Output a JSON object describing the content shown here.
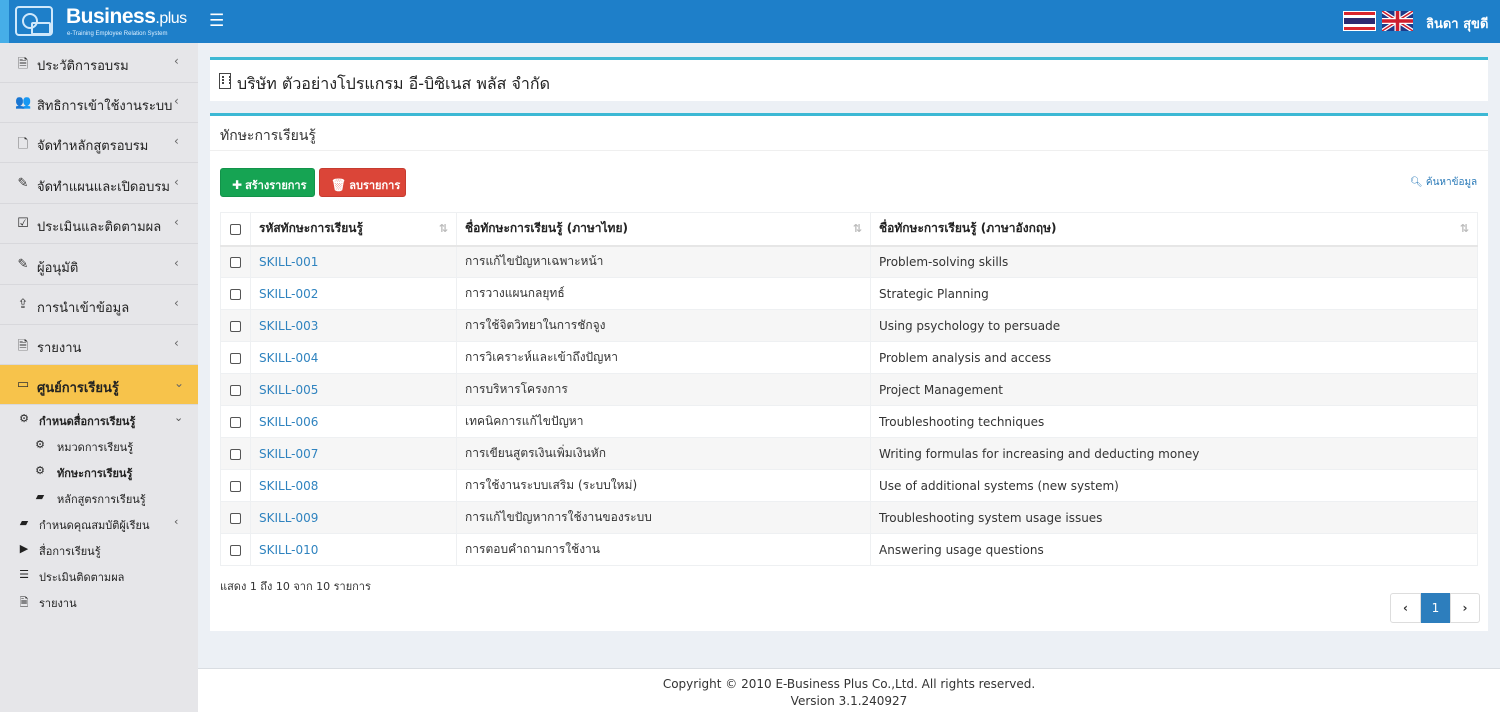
{
  "header": {
    "logo_title": "Business",
    "logo_title_suffix": ".plus",
    "logo_subtitle": "e-Training Employee Relation System",
    "menu_icon": "☰",
    "user_name": "ลินดา สุขดี",
    "flags": [
      "thai-flag-icon",
      "uk-flag-icon"
    ]
  },
  "sidebar": {
    "items": [
      {
        "icon": "document-icon",
        "glyph": "🗎",
        "label": "ประวัติการอบรม",
        "chevron": "‹"
      },
      {
        "icon": "users-icon",
        "glyph": "👥",
        "label": "สิทธิการเข้าใช้งานระบบ",
        "chevron": "‹"
      },
      {
        "icon": "file-icon",
        "glyph": "🗋",
        "label": "จัดทำหลักสูตรอบรม",
        "chevron": "‹"
      },
      {
        "icon": "edit-icon",
        "glyph": "✎",
        "label": "จัดทำแผนและเปิดอบรม",
        "chevron": "‹"
      },
      {
        "icon": "check-square-icon",
        "glyph": "☑",
        "label": "ประเมินและติดตามผล",
        "chevron": "‹"
      },
      {
        "icon": "edit-icon",
        "glyph": "✎",
        "label": "ผู้อนุมัติ",
        "chevron": "‹"
      },
      {
        "icon": "upload-icon",
        "glyph": "⇪",
        "label": "การนำเข้าข้อมูล",
        "chevron": "‹"
      },
      {
        "icon": "pdf-icon",
        "glyph": "🗎",
        "label": "รายงาน",
        "chevron": "‹"
      },
      {
        "icon": "monitor-icon",
        "glyph": "▭",
        "label": "ศูนย์การเรียนรู้",
        "chevron": "⌄"
      }
    ],
    "subitems": [
      {
        "icon": "gear-icon",
        "glyph": "⚙",
        "label": "กำหนดสื่อการเรียนรู้",
        "chevron": "⌄"
      },
      {
        "icon": "gear-icon",
        "glyph": "⚙",
        "label": "หมวดการเรียนรู้"
      },
      {
        "icon": "gear-icon",
        "glyph": "⚙",
        "label": "ทักษะการเรียนรู้"
      },
      {
        "icon": "book-icon",
        "glyph": "▰",
        "label": "หลักสูตรการเรียนรู้"
      },
      {
        "icon": "book-icon",
        "glyph": "▰",
        "label": "กำหนดคุณสมบัติผู้เรียน",
        "chevron": "‹"
      },
      {
        "icon": "video-icon",
        "glyph": "▶",
        "label": "สื่อการเรียนรู้"
      },
      {
        "icon": "list-icon",
        "glyph": "☰",
        "label": "ประเมินติดตามผล"
      },
      {
        "icon": "file-text-icon",
        "glyph": "🗎",
        "label": "รายงาน"
      }
    ]
  },
  "company": {
    "name": "บริษัท ตัวอย่างโปรแกรม อี-บิซิเนส พลัส จำกัด"
  },
  "skills": {
    "title": "ทักษะการเรียนรู้",
    "create_label": "สร้างรายการ",
    "delete_label": "ลบรายการ",
    "search_label": "ค้นหาข้อมูล",
    "columns": [
      "รหัสทักษะการเรียนรู้",
      "ชื่อทักษะการเรียนรู้ (ภาษาไทย)",
      "ชื่อทักษะการเรียนรู้ (ภาษาอังกฤษ)"
    ],
    "rows": [
      {
        "code": "SKILL-001",
        "name_th": "การแก้ไขปัญหาเฉพาะหน้า",
        "name_en": "Problem-solving skills"
      },
      {
        "code": "SKILL-002",
        "name_th": "การวางแผนกลยุทธ์",
        "name_en": "Strategic Planning"
      },
      {
        "code": "SKILL-003",
        "name_th": "การใช้จิตวิทยาในการชักจูง",
        "name_en": "Using psychology to persuade"
      },
      {
        "code": "SKILL-004",
        "name_th": "การวิเคราะห์และเข้าถึงปัญหา",
        "name_en": "Problem analysis and access"
      },
      {
        "code": "SKILL-005",
        "name_th": "การบริหารโครงการ",
        "name_en": "Project Management"
      },
      {
        "code": "SKILL-006",
        "name_th": "เทคนิคการแก้ไขปัญหา",
        "name_en": "Troubleshooting techniques"
      },
      {
        "code": "SKILL-007",
        "name_th": "การเขียนสูตรเงินเพิ่มเงินหัก",
        "name_en": "Writing formulas for increasing and deducting money"
      },
      {
        "code": "SKILL-008",
        "name_th": "การใช้งานระบบเสริม (ระบบใหม่)",
        "name_en": "Use of additional systems (new system)"
      },
      {
        "code": "SKILL-009",
        "name_th": "การแก้ไขปัญหาการใช้งานของระบบ",
        "name_en": "Troubleshooting system usage issues"
      },
      {
        "code": "SKILL-010",
        "name_th": "การตอบคำถามการใช้งาน",
        "name_en": "Answering usage questions"
      }
    ],
    "info": "แสดง 1 ถึง 10 จาก 10 รายการ",
    "pagination": {
      "prev": "‹",
      "current": "1",
      "next": "›"
    }
  },
  "footer": {
    "copyright": "Copyright © 2010 E-Business Plus Co.,Ltd. All rights reserved.",
    "version": "Version 3.1.240927"
  },
  "colors": {
    "topbar": "#1e7fc9",
    "active_menu": "#f7c34b",
    "create_button": "#16a453",
    "delete_button": "#db4538",
    "link": "#2f83bf",
    "panel_accent": "#3cb8d4"
  }
}
